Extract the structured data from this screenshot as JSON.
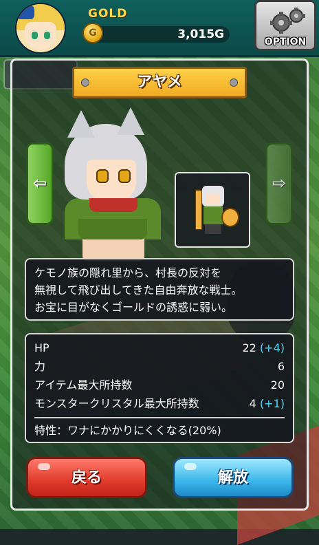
{
  "header": {
    "gold_label": "GOLD",
    "gold_value": "3,015G",
    "option_label": "OPTION"
  },
  "character": {
    "name": "アヤメ",
    "description": [
      "ケモノ族の隠れ里から、村長の反対を",
      "無視して飛び出してきた自由奔放な戦士。",
      "お宝に目がなくゴールドの誘惑に弱い。"
    ],
    "stats": [
      {
        "label": "HP",
        "value": "22",
        "bonus": "(+4)"
      },
      {
        "label": "力",
        "value": "6",
        "bonus": ""
      },
      {
        "label": "アイテム最大所持数",
        "value": "20",
        "bonus": ""
      },
      {
        "label": "モンスタークリスタル最大所持数",
        "value": "4",
        "bonus": "(+1)"
      }
    ],
    "trait": "特性：ワナにかかりにくくなる(20%)"
  },
  "buttons": {
    "back_label": "戻る",
    "release_label": "解放",
    "prev_glyph": "⇦",
    "next_glyph": "⇨"
  },
  "colors": {
    "header_bg": "#0f5f5c",
    "name_plate": "#ffd24a",
    "back_button": "#e03a2a",
    "release_button": "#3ab6ea",
    "bonus_text": "#4fd8ff"
  }
}
